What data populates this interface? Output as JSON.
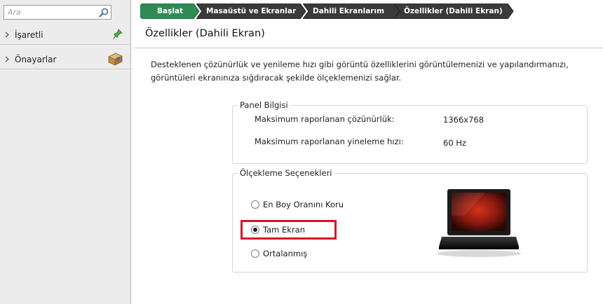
{
  "search": {
    "placeholder": "Ara",
    "value": ""
  },
  "sidebar": {
    "items": [
      {
        "label": "İşaretli",
        "icon": "pin-icon"
      },
      {
        "label": "Önayarlar",
        "icon": "preset-box-icon"
      }
    ]
  },
  "breadcrumb": [
    {
      "label": "Başlat",
      "active": true
    },
    {
      "label": "Masaüstü ve Ekranlar",
      "active": false
    },
    {
      "label": "Dahili Ekranlarım",
      "active": false
    },
    {
      "label": "Özellikler (Dahili Ekran)",
      "active": false
    }
  ],
  "page": {
    "title": "Özellikler (Dahili Ekran)",
    "description": "Desteklenen çözünürlük ve yenileme hızı gibi görüntü özelliklerini görüntülemenizi ve yapılandırmanızı, görüntüleri ekranınıza sığdıracak şekilde ölçeklemenizi sağlar."
  },
  "panel_info": {
    "legend": "Panel Bilgisi",
    "rows": [
      {
        "label": "Maksimum raporlanan çözünürlük:",
        "value": "1366x768"
      },
      {
        "label": "Maksimum raporlanan yineleme hızı:",
        "value": "60 Hz"
      }
    ]
  },
  "scaling": {
    "legend": "Ölçekleme Seçenekleri",
    "options": [
      {
        "label": "En Boy Oranını Koru",
        "selected": false
      },
      {
        "label": "Tam Ekran",
        "selected": true
      },
      {
        "label": "Ortalanmış",
        "selected": false
      }
    ]
  },
  "colors": {
    "breadcrumb_active": "#2f8a54",
    "breadcrumb_inactive": "#3a3a3a",
    "highlight": "#d9142b",
    "sidebar_bg": "#ececec"
  }
}
